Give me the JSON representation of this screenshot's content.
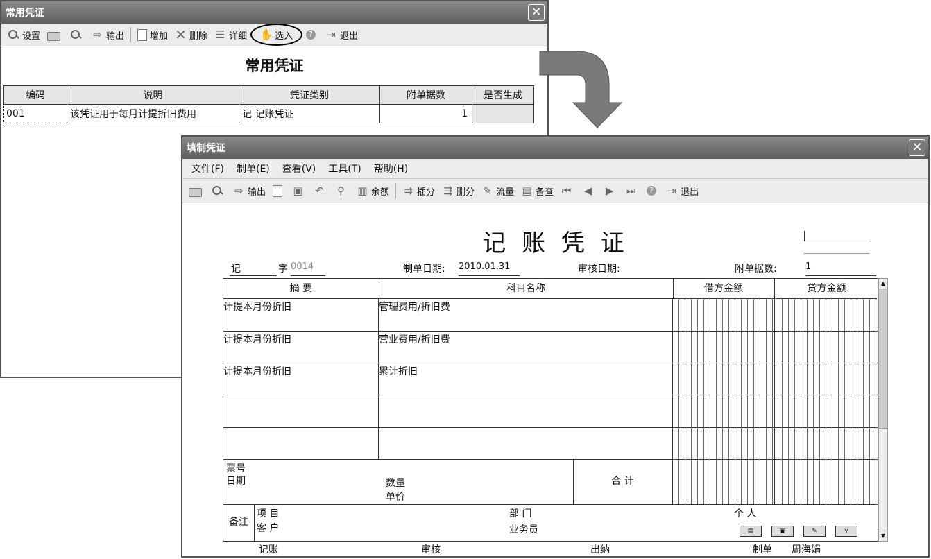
{
  "top_window": {
    "title": "常用凭证",
    "toolbar": [
      {
        "label": "设置",
        "icon": "settings-icon"
      },
      {
        "label": "",
        "icon": "print-icon"
      },
      {
        "label": "",
        "icon": "preview-icon"
      },
      {
        "label": "输出",
        "icon": "export-icon"
      },
      {
        "label": "增加",
        "icon": "new-document-icon"
      },
      {
        "label": "删除",
        "icon": "delete-icon"
      },
      {
        "label": "详细",
        "icon": "detail-icon"
      },
      {
        "label": "选入",
        "icon": "hand-icon"
      },
      {
        "label": "",
        "icon": "help-icon"
      },
      {
        "label": "退出",
        "icon": "exit-icon"
      }
    ],
    "heading": "常用凭证",
    "columns": [
      "编码",
      "说明",
      "凭证类别",
      "附单据数",
      "是否生成"
    ],
    "rows": [
      {
        "code": "001",
        "desc": "该凭证用于每月计提折旧费用",
        "category": "记 记账凭证",
        "attachments": "1",
        "generated": ""
      }
    ]
  },
  "voucher_window": {
    "title": "填制凭证",
    "menu": [
      "文件(F)",
      "制单(E)",
      "查看(V)",
      "工具(T)",
      "帮助(H)"
    ],
    "toolbar": [
      {
        "label": "",
        "icon": "print-icon"
      },
      {
        "label": "",
        "icon": "preview-icon"
      },
      {
        "label": "输出",
        "icon": "export-icon"
      },
      {
        "label": "",
        "icon": "add-icon"
      },
      {
        "label": "",
        "icon": "save-icon"
      },
      {
        "label": "",
        "icon": "undo-icon"
      },
      {
        "label": "",
        "icon": "find-icon"
      },
      {
        "label": "余额",
        "icon": "balance-icon"
      },
      {
        "label": "插分",
        "icon": "insert-row-icon"
      },
      {
        "label": "删分",
        "icon": "delete-row-icon"
      },
      {
        "label": "流量",
        "icon": "flow-icon"
      },
      {
        "label": "备查",
        "icon": "reference-icon"
      },
      {
        "label": "",
        "icon": "first-icon"
      },
      {
        "label": "",
        "icon": "prev-icon"
      },
      {
        "label": "",
        "icon": "next-icon"
      },
      {
        "label": "",
        "icon": "last-icon"
      },
      {
        "label": "",
        "icon": "help-icon"
      },
      {
        "label": "退出",
        "icon": "exit-icon"
      }
    ],
    "voucher_title": "记 账 凭 证",
    "voucher_type": "记",
    "zi_label": "字",
    "voucher_number": "0014",
    "date_label": "制单日期:",
    "date_value": "2010.01.31",
    "audit_date_label": "审核日期:",
    "attach_label": "附单据数:",
    "attach_value": "1",
    "col_summary": "摘 要",
    "col_account": "科目名称",
    "col_debit": "借方金额",
    "col_credit": "贷方金额",
    "entries": [
      {
        "summary": "计提本月份折旧",
        "account": "管理费用/折旧费"
      },
      {
        "summary": "计提本月份折旧",
        "account": "营业费用/折旧费"
      },
      {
        "summary": "计提本月份折旧",
        "account": "累计折旧"
      },
      {
        "summary": "",
        "account": ""
      },
      {
        "summary": "",
        "account": ""
      }
    ],
    "ticket_no_label": "票号",
    "ticket_date_label": "日期",
    "qty_label": "数量",
    "price_label": "单价",
    "total_label": "合 计",
    "remark_label": "备注",
    "project_label": "项 目",
    "customer_label": "客 户",
    "dept_label": "部 门",
    "salesman_label": "业务员",
    "person_label": "个 人",
    "footer": {
      "bookkeeping": "记账",
      "audit": "审核",
      "cashier": "出纳",
      "maker_label": "制单",
      "maker_name": "周海娟"
    }
  }
}
